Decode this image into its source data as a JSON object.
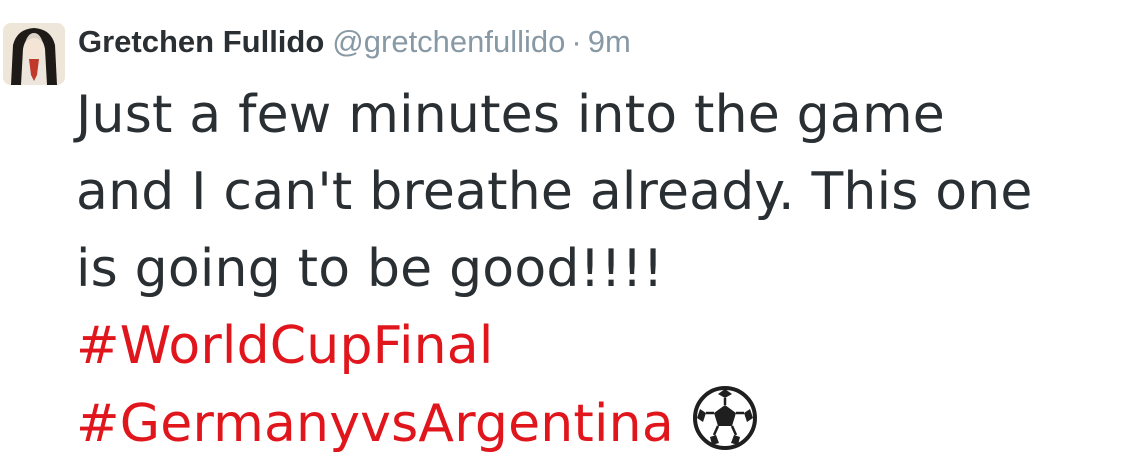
{
  "tweet": {
    "author": {
      "name": "Gretchen Fullido",
      "handle": "@gretchenfullido",
      "avatar_icon": "profile-photo"
    },
    "separator": "·",
    "timestamp": "9m",
    "text_lines": [
      "Just a few minutes into the game",
      "and I can't breathe already. This one",
      "is going to be good!!!!"
    ],
    "hashtags": [
      "#WorldCupFinal",
      "#GermanyvsArgentina"
    ],
    "emoji": "soccer-ball-icon",
    "colors": {
      "text": "#292f33",
      "muted": "#8899a6",
      "hashtag": "#e0161c"
    }
  }
}
